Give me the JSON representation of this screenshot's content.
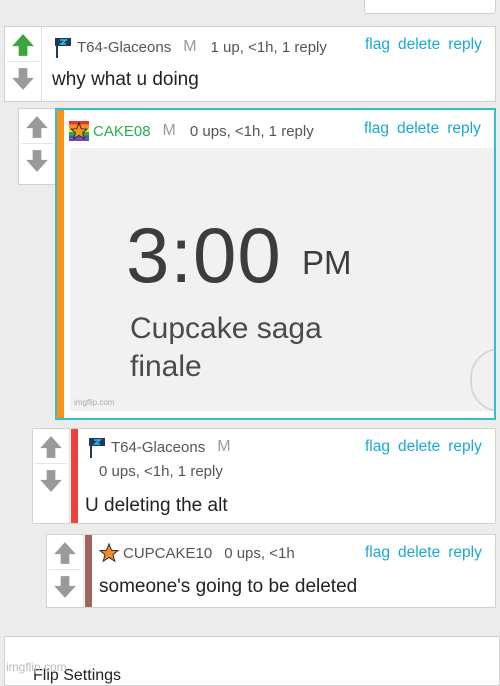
{
  "colors": {
    "link": "#1aa9d4",
    "green_user": "#22b14c",
    "accent_orange": "#f7941d",
    "accent_red": "#ef3f3f",
    "accent_brown": "#a0645a",
    "upvote_active": "#3aa53a",
    "vote_inactive": "#9a9a9a"
  },
  "actions": {
    "flag": "flag",
    "delete": "delete",
    "reply": "reply"
  },
  "comments": [
    {
      "username": "T64-Glaceons",
      "mod": "M",
      "stats": "1 up, <1h, 1 reply",
      "text": "why what u doing",
      "upvoted": true,
      "badge_icon": "flag-icon"
    },
    {
      "username": "CAKE08",
      "mod": "M",
      "stats": "0 ups, <1h, 1 reply",
      "text": "",
      "upvoted": false,
      "badge_icon": "rainbow-star-icon",
      "meme": {
        "time": "3:00",
        "ampm": "PM",
        "caption_line1": "Cupcake saga",
        "caption_line2": "finale",
        "watermark": "imgflip.com"
      }
    },
    {
      "username": "T64-Glaceons",
      "mod": "M",
      "stats": "0 ups, <1h, 1 reply",
      "text": "U deleting the alt",
      "upvoted": false,
      "badge_icon": "flag-icon"
    },
    {
      "username": "CUPCAKE10",
      "mod": "",
      "stats": "0 ups, <1h",
      "text": "someone's going to be deleted",
      "upvoted": false,
      "badge_icon": "orange-star-icon"
    }
  ],
  "footer": {
    "settings_label": "Flip Settings",
    "watermark": "imgflip.com"
  }
}
